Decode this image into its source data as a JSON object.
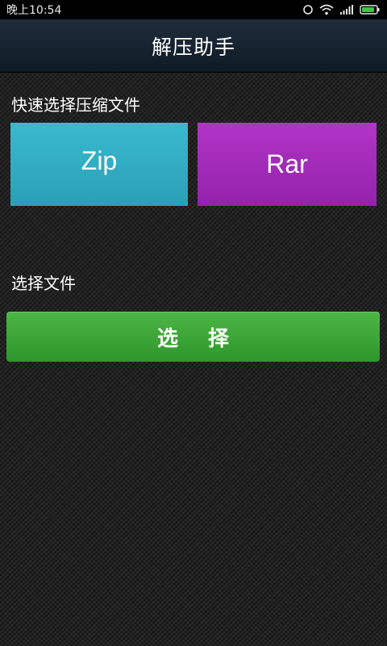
{
  "status_bar": {
    "time": "晚上10:54",
    "icons": [
      "alarm-icon",
      "wifi-icon",
      "signal-icon",
      "battery-icon"
    ]
  },
  "app": {
    "title": "解压助手"
  },
  "quick_select": {
    "label": "快速选择压缩文件",
    "tiles": [
      {
        "label": "Zip",
        "color": "#34afc6"
      },
      {
        "label": "Rar",
        "color": "#a22cb9"
      }
    ]
  },
  "choose_file": {
    "label": "选择文件",
    "button_label": "选 择",
    "button_color": "#3aa635"
  }
}
